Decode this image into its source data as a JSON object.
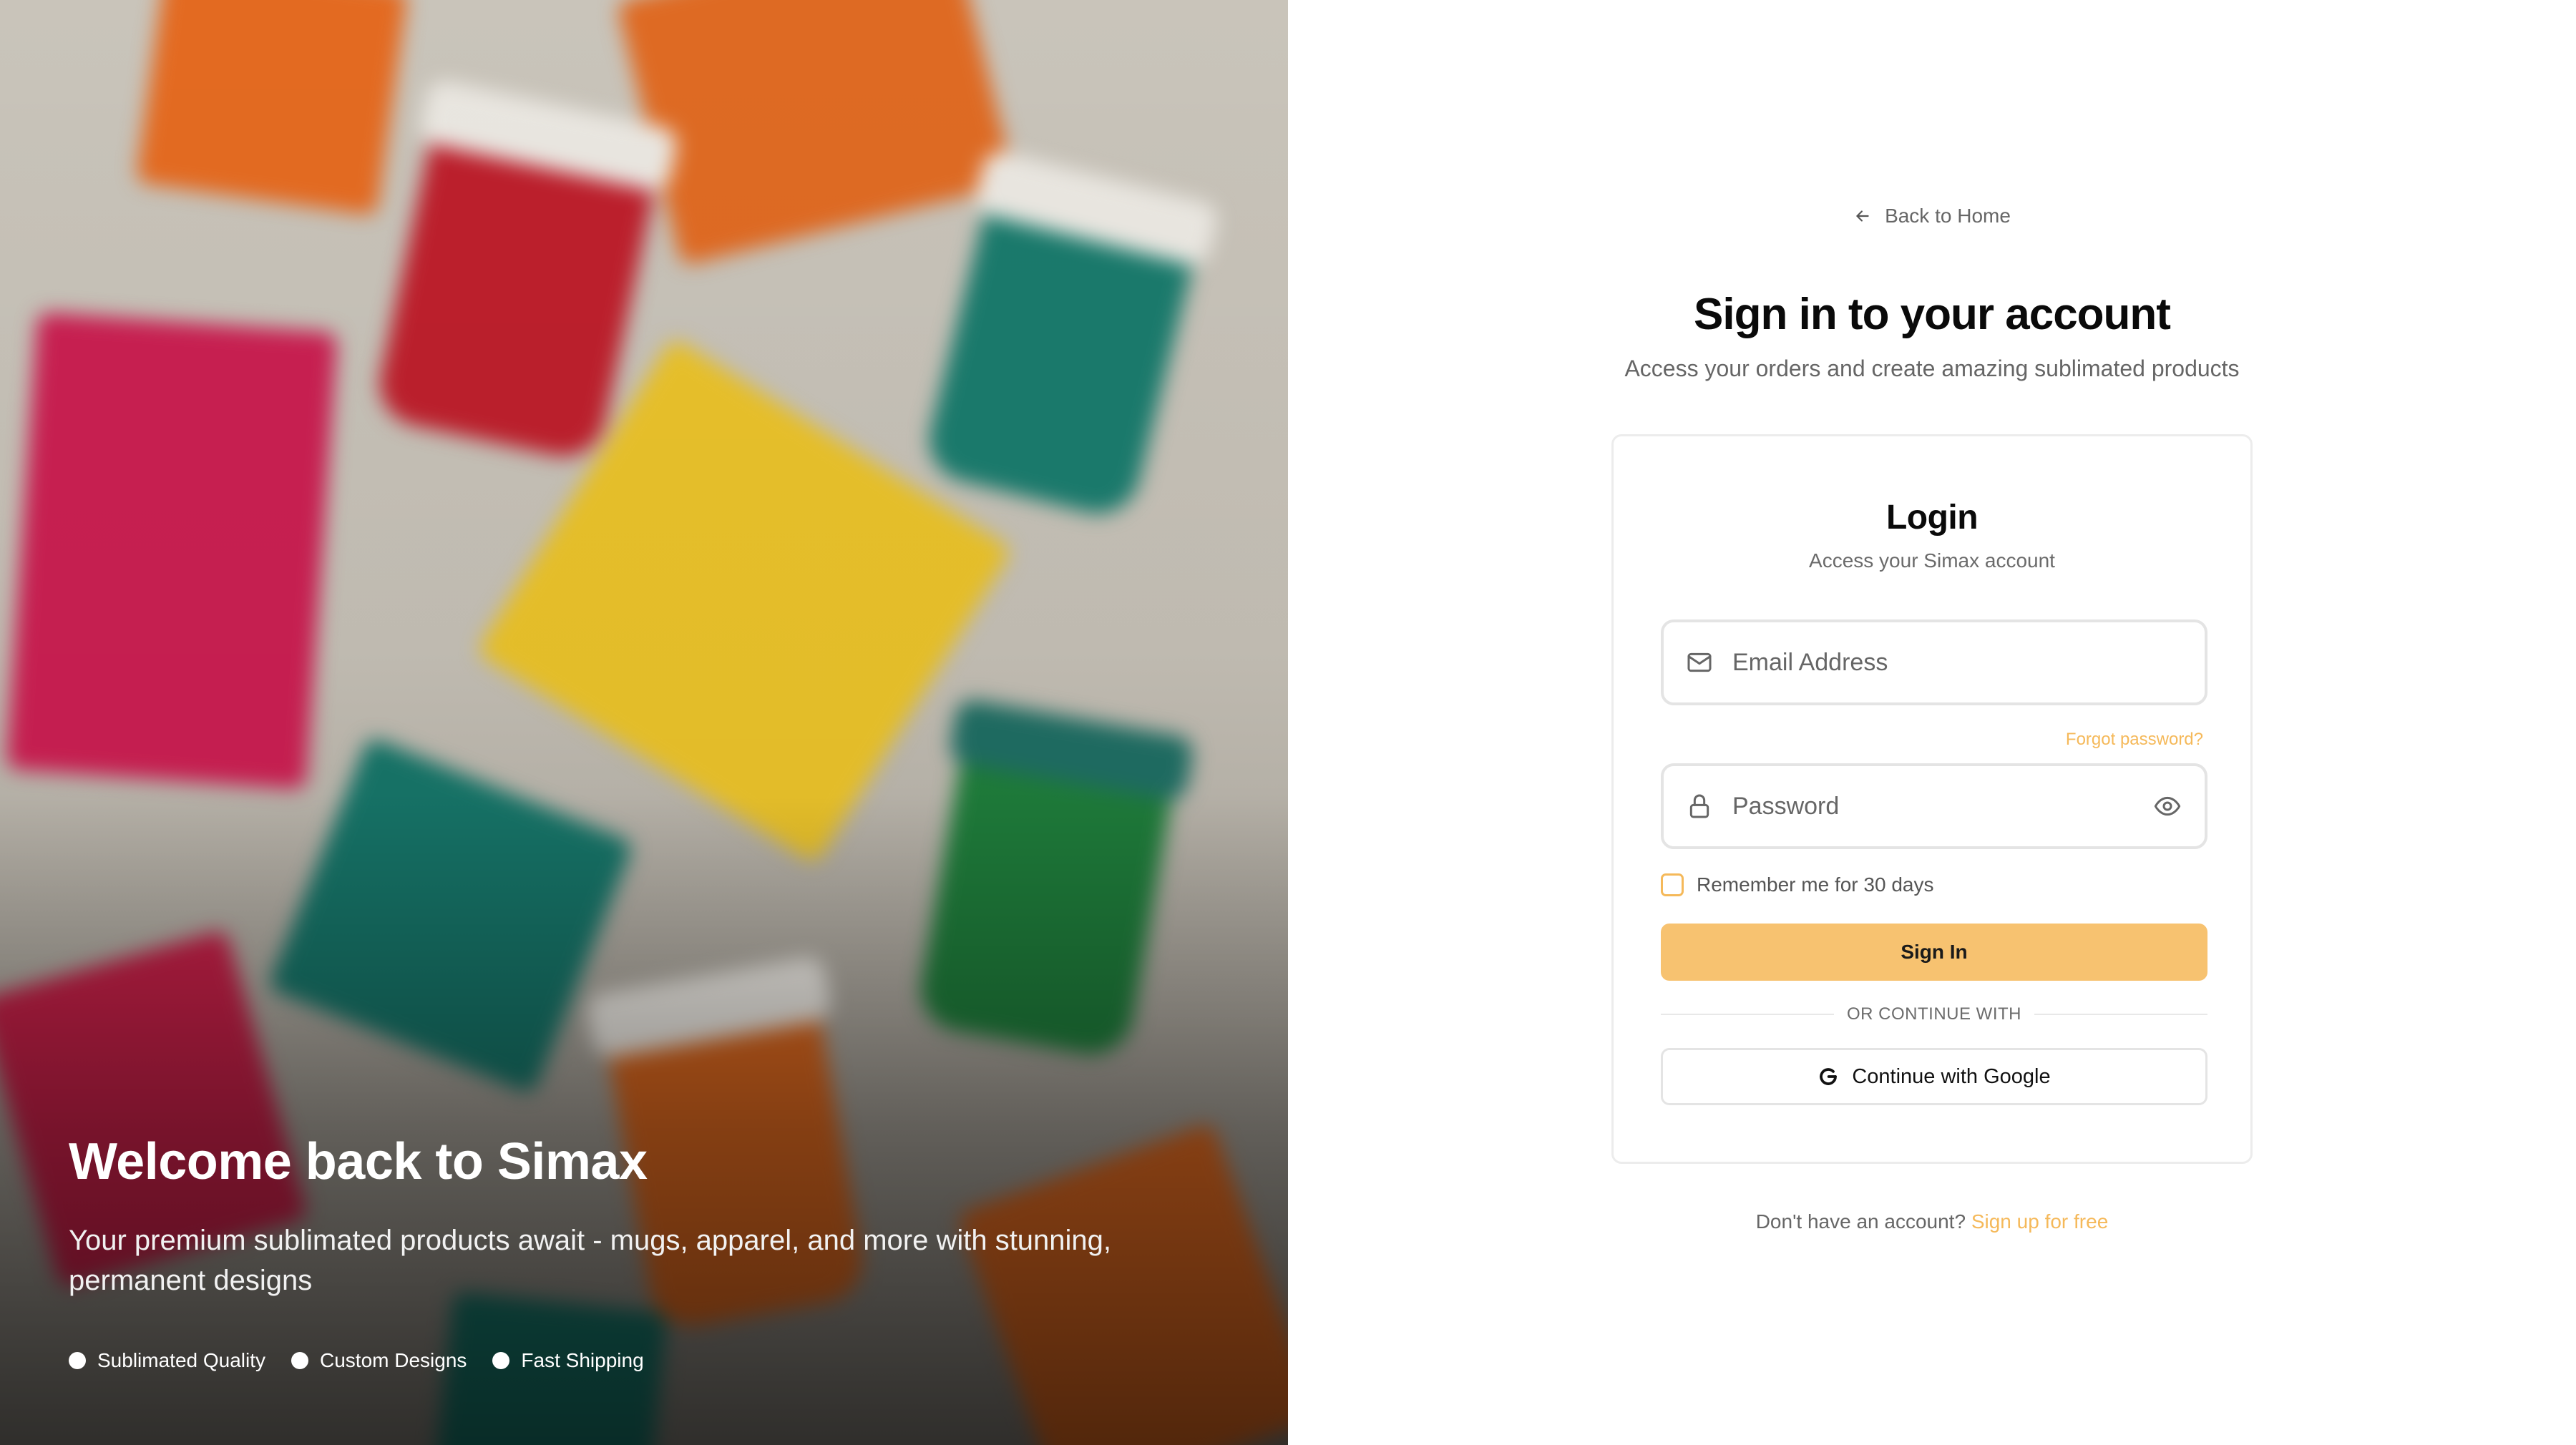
{
  "hero": {
    "title": "Welcome back to Simax",
    "subtitle": "Your premium sublimated products await - mugs, apparel, and more with stunning, permanent designs",
    "features": [
      "Sublimated Quality",
      "Custom Designs",
      "Fast Shipping"
    ]
  },
  "auth": {
    "back_label": "Back to Home",
    "title": "Sign in to your account",
    "subtitle": "Access your orders and create amazing sublimated products",
    "card": {
      "title": "Login",
      "subtitle": "Access your Simax account",
      "email_placeholder": "Email Address",
      "email_value": "",
      "forgot_label": "Forgot password?",
      "password_placeholder": "Password",
      "password_value": "",
      "remember_label": "Remember me for 30 days",
      "remember_checked": false,
      "signin_label": "Sign In",
      "divider_label": "OR CONTINUE WITH",
      "google_label": "Continue with Google"
    },
    "signup_prompt": "Don't have an account?",
    "signup_link": "Sign up for free"
  },
  "colors": {
    "accent": "#f5b95a",
    "button": "#f7c270"
  },
  "icons": {
    "back": "arrow-left-icon",
    "email": "mail-icon",
    "password": "lock-icon",
    "toggle": "eye-icon",
    "google": "google-icon"
  }
}
